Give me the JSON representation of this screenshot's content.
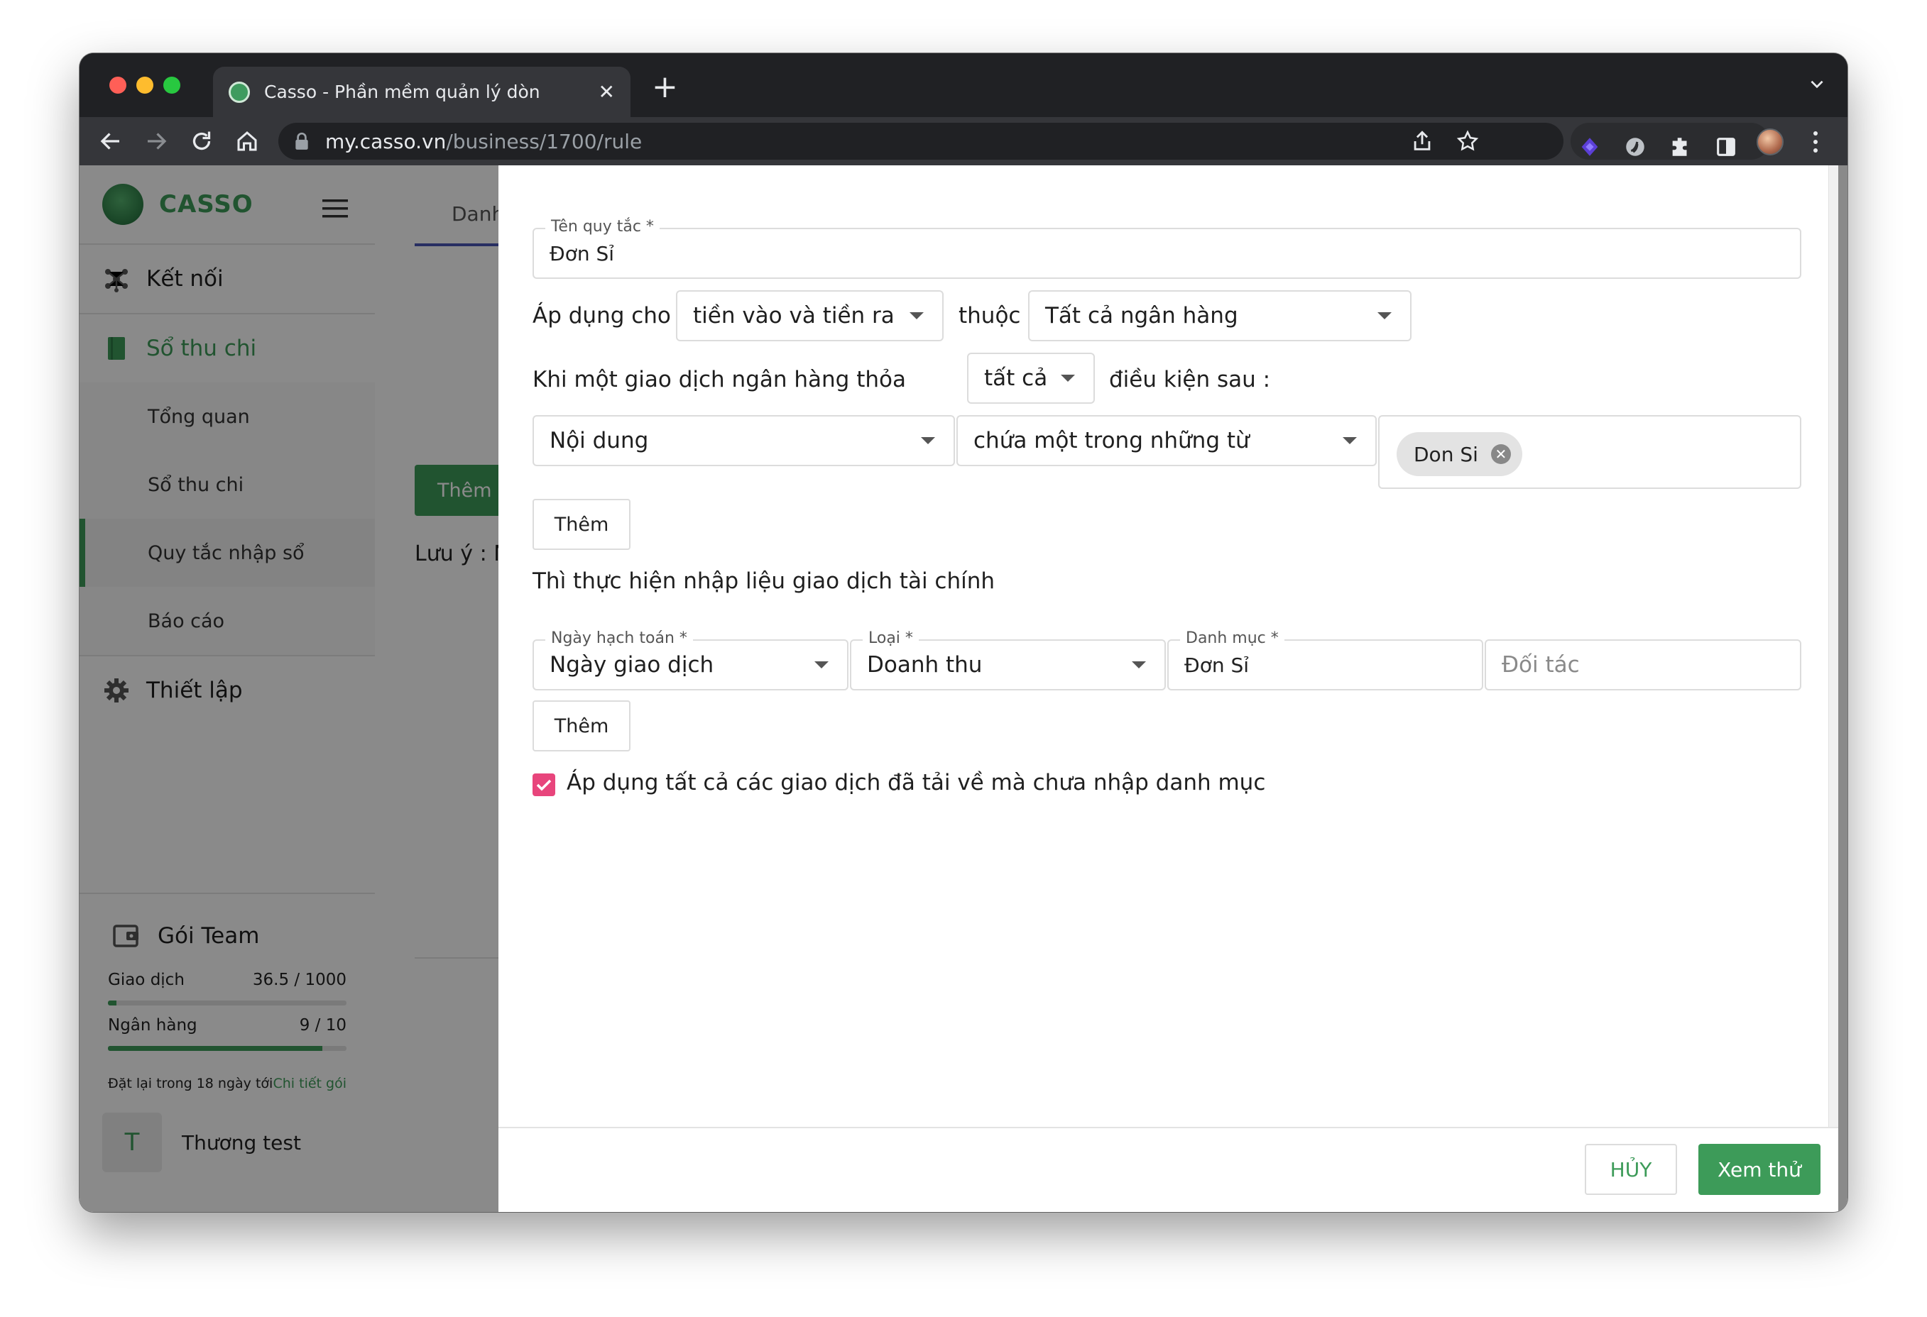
{
  "browser": {
    "tab_title": "Casso - Phần mềm quản lý dòn",
    "url_host": "my.casso.vn",
    "url_path": "/business/1700/rule"
  },
  "sidebar": {
    "brand": "CASSO",
    "items": [
      {
        "label": "Kết nối",
        "icon": "network-icon"
      },
      {
        "label": "Sổ thu chi",
        "icon": "book-icon"
      },
      {
        "label": "Thiết lập",
        "icon": "gear-icon"
      }
    ],
    "subitems": [
      "Tổng quan",
      "Sổ thu chi",
      "Quy tắc nhập sổ",
      "Báo cáo"
    ],
    "active_subitem": "Quy tắc nhập sổ",
    "plan": {
      "title": "Gói Team",
      "transactions_label": "Giao dịch",
      "transactions_value": "36.5 / 1000",
      "transactions_fraction": 0.0365,
      "banks_label": "Ngân hàng",
      "banks_value": "9 / 10",
      "banks_fraction": 0.9,
      "reset_text": "Đặt lại trong 18 ngày tới",
      "detail_link": "Chi tiết gói"
    },
    "user": {
      "initial": "T",
      "name": "Thương test"
    }
  },
  "background_page": {
    "tab_label": "Danh",
    "add_button": "Thêm",
    "note": "Lưu ý : N"
  },
  "dialog": {
    "rule_name": {
      "label": "Tên quy tắc *",
      "value": "Đơn Sỉ"
    },
    "apply_for_label": "Áp dụng cho",
    "apply_for_value": "tiền vào và tiền ra",
    "belongs_label": "thuộc",
    "belongs_value": "Tất cả ngân hàng",
    "when_label": "Khi một giao dịch ngân hàng thỏa",
    "match_value": "tất cả",
    "conditions_label": "điều kiện sau :",
    "condition": {
      "field": "Nội dung",
      "operator": "chứa một trong những từ",
      "chips": [
        "Don Si"
      ]
    },
    "add_condition_button": "Thêm",
    "then_label": "Thì thực hiện nhập liệu giao dịch tài chính",
    "action": {
      "date": {
        "label": "Ngày hạch toán *",
        "value": "Ngày giao dịch"
      },
      "type": {
        "label": "Loại *",
        "value": "Doanh thu"
      },
      "category": {
        "label": "Danh mục *",
        "value": "Đơn Sỉ"
      },
      "partner_placeholder": "Đối tác"
    },
    "add_action_button": "Thêm",
    "apply_all_checked": true,
    "apply_all_label": "Áp dụng tất cả các giao dịch đã tải về mà chưa nhập danh mục",
    "cancel_button": "HỦY",
    "preview_button": "Xem thử"
  },
  "colors": {
    "brand_green": "#3d9b59",
    "checkbox_pink": "#e8457c",
    "tab_indicator": "#4a56b5"
  }
}
